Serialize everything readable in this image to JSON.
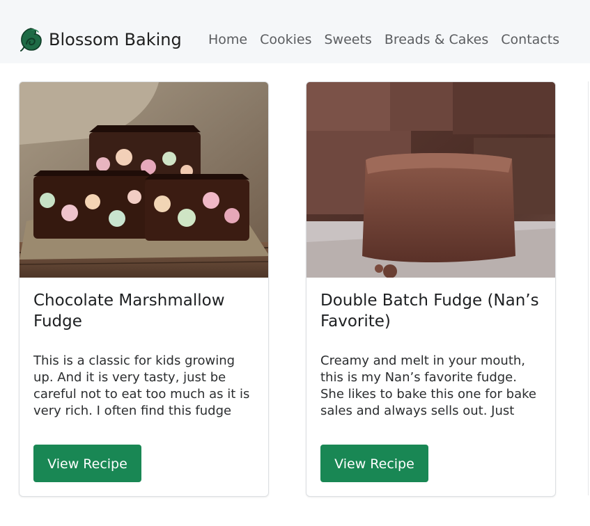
{
  "brand": {
    "name": "Blossom Baking",
    "logo_icon": "leaf-swirl-icon",
    "logo_color": "#1e6b46"
  },
  "nav": {
    "items": [
      {
        "label": "Home"
      },
      {
        "label": "Cookies"
      },
      {
        "label": "Sweets"
      },
      {
        "label": "Breads & Cakes"
      },
      {
        "label": "Contacts"
      }
    ]
  },
  "cards": [
    {
      "image_icon": "chocolate-marshmallow-fudge-photo",
      "title": "Chocolate Marshmallow Fudge",
      "text": "This is a classic for kids growing up. And it is very tasty, just be careful not to eat too much as it is very rich. I often find this fudge at…",
      "button_label": "View Recipe"
    },
    {
      "image_icon": "double-batch-fudge-photo",
      "title": "Double Batch Fudge (Nan’s Favorite)",
      "text": "Creamy and melt in your mouth, this is my Nan’s favorite fudge. She likes to bake this one for bake sales and always sells out. Just don’t eat…",
      "button_label": "View Recipe"
    }
  ],
  "colors": {
    "navbar_bg": "#f5f7f9",
    "button_bg": "#198754",
    "button_text": "#ffffff"
  }
}
